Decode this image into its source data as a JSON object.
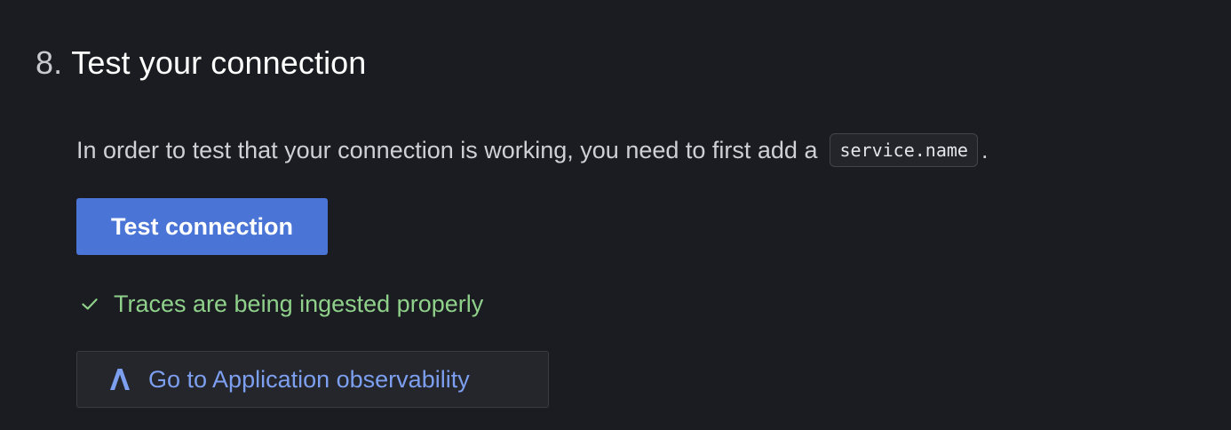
{
  "step": {
    "number": "8.",
    "title": "Test your connection"
  },
  "description": {
    "text": "In order to test that your connection is working, you need to first add a",
    "code": "service.name",
    "suffix": "."
  },
  "test_button": {
    "label": "Test connection"
  },
  "status": {
    "icon": "check-icon",
    "text": "Traces are being ingested properly",
    "color": "#8fd18a"
  },
  "app_button": {
    "icon": "application-observability-icon",
    "label": "Go to Application observability"
  },
  "colors": {
    "background": "#1b1c21",
    "primary": "#4a75d6",
    "link": "#7d9ff0",
    "success": "#8fd18a"
  }
}
